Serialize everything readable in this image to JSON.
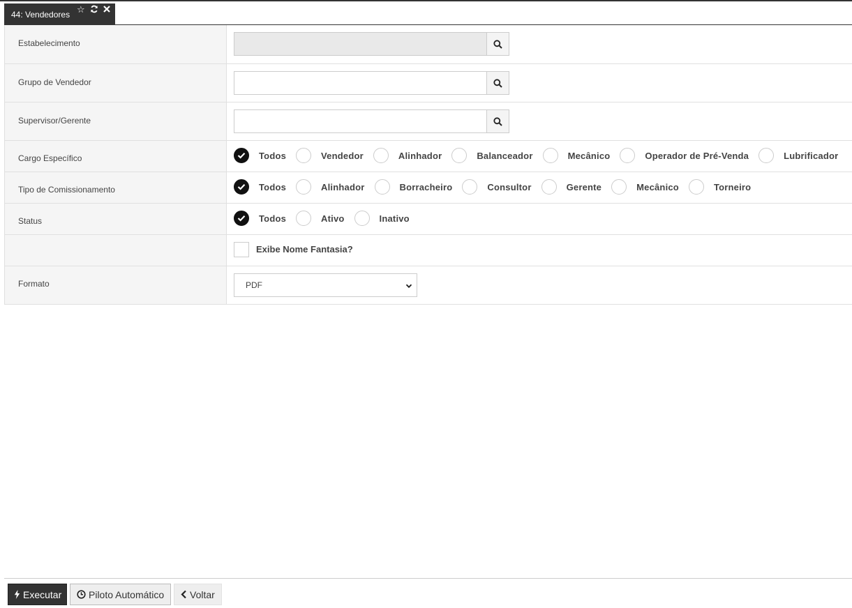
{
  "tab": {
    "title": "44: Vendedores",
    "icons": [
      "star-icon",
      "refresh-icon",
      "close-icon"
    ]
  },
  "form": {
    "estabelecimento": {
      "label": "Estabelecimento",
      "value": ""
    },
    "grupo_vendedor": {
      "label": "Grupo de Vendedor",
      "value": ""
    },
    "supervisor": {
      "label": "Supervisor/Gerente",
      "value": ""
    },
    "cargo": {
      "label": "Cargo Específico",
      "options": [
        "Todos",
        "Vendedor",
        "Alinhador",
        "Balanceador",
        "Mecânico",
        "Operador de Pré-Venda",
        "Lubrificador"
      ],
      "selected": "Todos"
    },
    "comissionamento": {
      "label": "Tipo de Comissionamento",
      "options": [
        "Todos",
        "Alinhador",
        "Borracheiro",
        "Consultor",
        "Gerente",
        "Mecânico",
        "Torneiro"
      ],
      "selected": "Todos"
    },
    "status": {
      "label": "Status",
      "options": [
        "Todos",
        "Ativo",
        "Inativo"
      ],
      "selected": "Todos"
    },
    "nome_fantasia": {
      "label": "Exibe Nome Fantasia?",
      "checked": false
    },
    "formato": {
      "label": "Formato",
      "value": "PDF"
    }
  },
  "footer": {
    "executar": "Executar",
    "piloto": "Piloto Automático",
    "voltar": "Voltar"
  },
  "colors": {
    "dark": "#333333",
    "label_bg": "#f5f5f5",
    "border": "#e0e0e0",
    "disabled_input": "#e9e9e9"
  }
}
